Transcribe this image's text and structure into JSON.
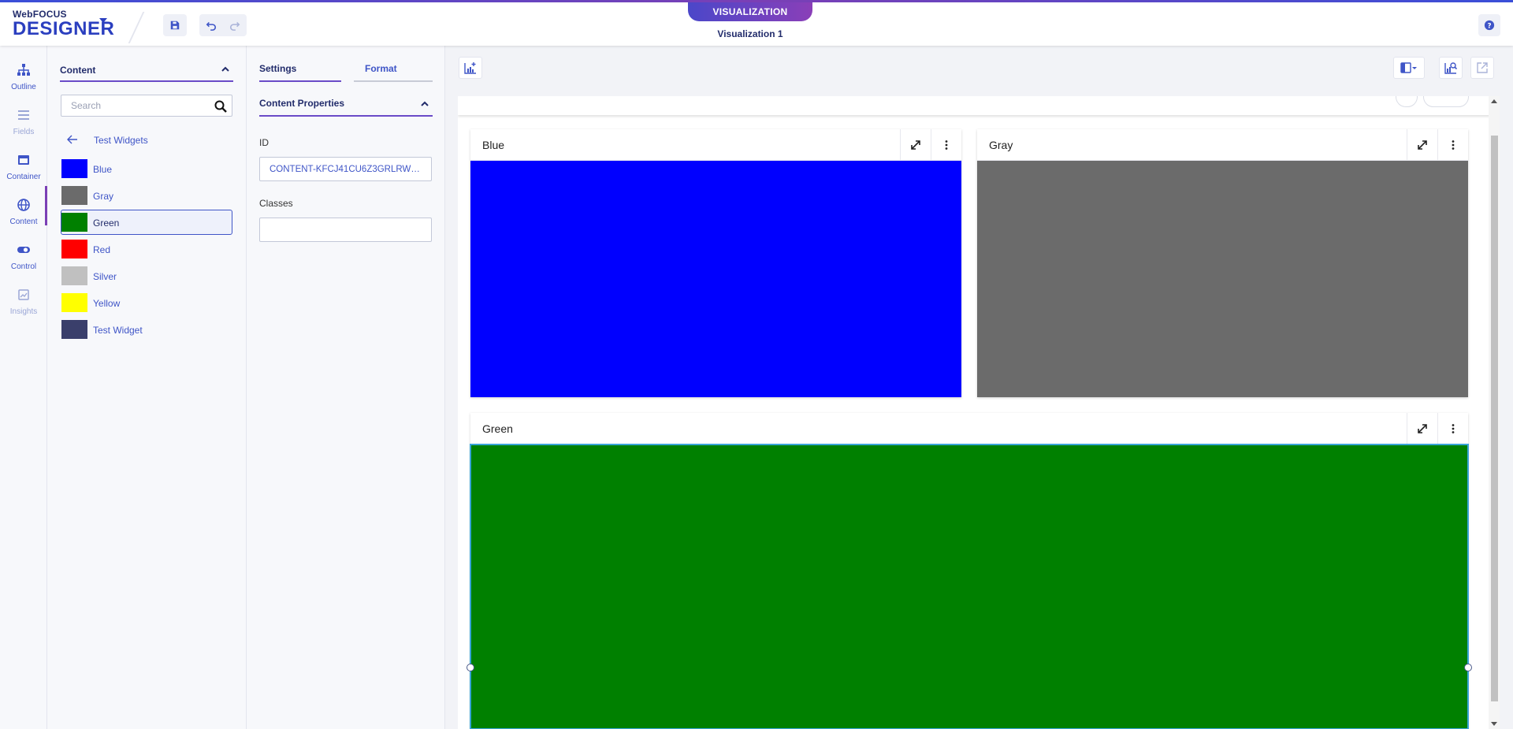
{
  "header": {
    "brand_small": "WebFOCUS",
    "brand_big": "DESIGNER",
    "mode_tab": "VISUALIZATION",
    "doc_title": "Visualization 1"
  },
  "rail": {
    "items": [
      {
        "label": "Outline",
        "icon": "outline-icon"
      },
      {
        "label": "Fields",
        "icon": "fields-icon"
      },
      {
        "label": "Container",
        "icon": "container-icon"
      },
      {
        "label": "Content",
        "icon": "globe-icon"
      },
      {
        "label": "Control",
        "icon": "toggle-icon"
      },
      {
        "label": "Insights",
        "icon": "insights-icon"
      }
    ]
  },
  "content_panel": {
    "title": "Content",
    "search_placeholder": "Search",
    "back_label": "Test Widgets",
    "widgets": [
      {
        "label": "Blue",
        "color": "#0000ff"
      },
      {
        "label": "Gray",
        "color": "#6b6b6b"
      },
      {
        "label": "Green",
        "color": "#008000"
      },
      {
        "label": "Red",
        "color": "#ff0000"
      },
      {
        "label": "Silver",
        "color": "#c0c0c0"
      },
      {
        "label": "Yellow",
        "color": "#ffff00"
      },
      {
        "label": "Test Widget",
        "color": "#3a3f6b"
      }
    ]
  },
  "props_panel": {
    "tab_settings": "Settings",
    "tab_format": "Format",
    "section_title": "Content Properties",
    "id_label": "ID",
    "id_value": "CONTENT-KFCJ41CU6Z3GRLRWP…",
    "classes_label": "Classes",
    "classes_value": ""
  },
  "canvas": {
    "widgets": [
      {
        "title": "Blue",
        "color": "#0000ff"
      },
      {
        "title": "Gray",
        "color": "#6b6b6b"
      },
      {
        "title": "Green",
        "color": "#008000"
      }
    ]
  },
  "colors": {
    "accent": "#3f55c7",
    "accent_purple": "#7b3fb5",
    "selection": "#3aa5d8"
  }
}
